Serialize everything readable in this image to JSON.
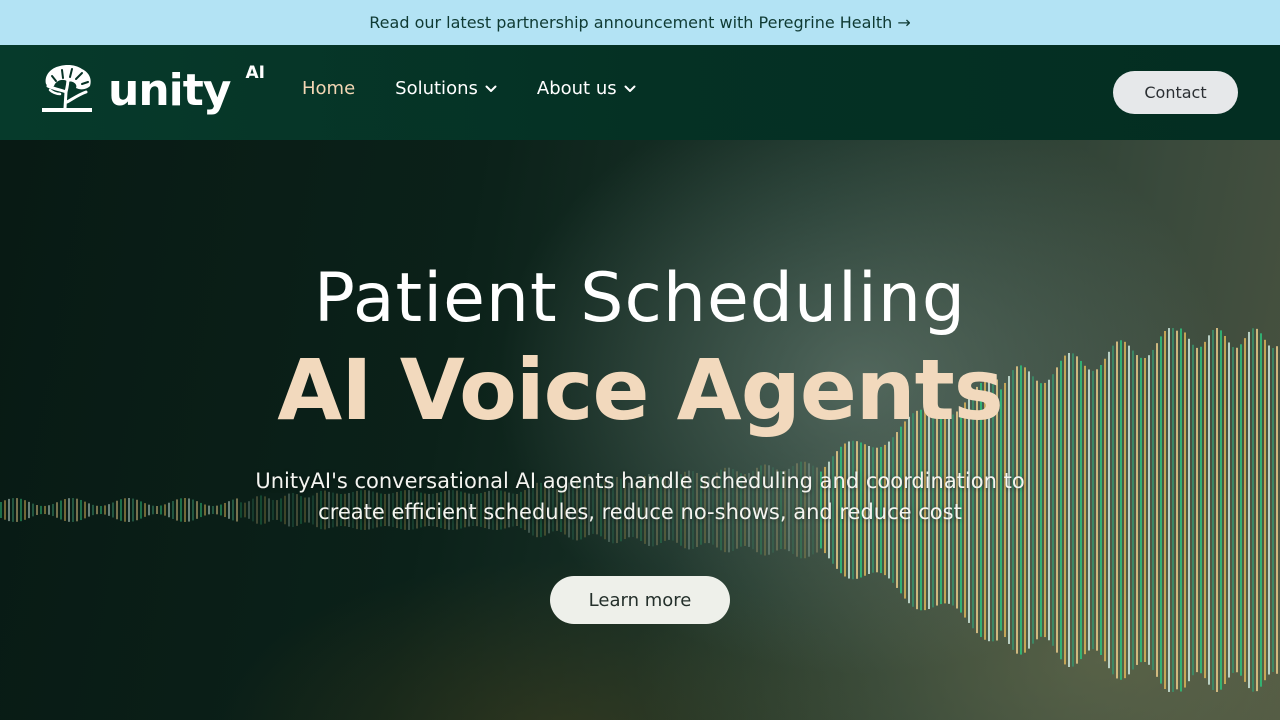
{
  "announcement": {
    "text": "Read our latest partnership announcement with Peregrine Health",
    "arrow": "→"
  },
  "nav": {
    "logo_word": "unity",
    "logo_sup": "AI",
    "logo_icon": "tree-logo-icon",
    "links": [
      {
        "label": "Home",
        "active": true,
        "has_dropdown": false
      },
      {
        "label": "Solutions",
        "active": false,
        "has_dropdown": true
      },
      {
        "label": "About us",
        "active": false,
        "has_dropdown": true
      }
    ],
    "contact_label": "Contact"
  },
  "hero": {
    "title": "Patient Scheduling",
    "highlight": "AI Voice Agents",
    "subtitle": "UnityAI's conversational AI agents handle scheduling and coordination to create efficient schedules, reduce no-shows, and reduce cost",
    "cta_label": "Learn more"
  },
  "colors": {
    "announcement_bg": "#b3e3f4",
    "nav_bg": "#053124",
    "active_link": "#f3d6b4",
    "highlight": "#f2d9bd",
    "button_bg": "#eef0ea",
    "wave_green": "#2fbf7a",
    "wave_gold": "#d9b45a",
    "wave_light": "#cfe6dc"
  }
}
